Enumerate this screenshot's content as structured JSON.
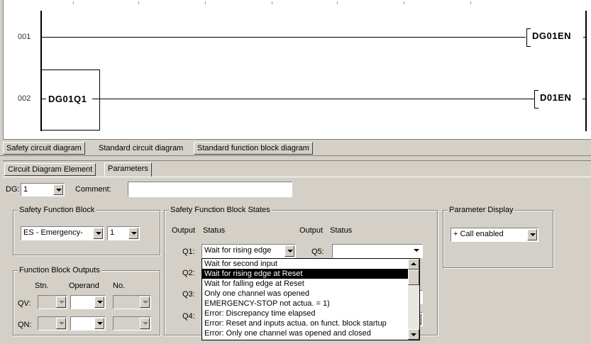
{
  "diagram": {
    "rungs": [
      {
        "number": "001",
        "contact": "",
        "coil": "DG01EN"
      },
      {
        "number": "002",
        "contact": "DG01Q1",
        "coil": "D01EN"
      }
    ]
  },
  "diagram_tabs": [
    "Safety circuit diagram",
    "Standard circuit diagram",
    "Standard function block diagram"
  ],
  "panel_tabs": [
    "Circuit Diagram Element",
    "Parameters"
  ],
  "header": {
    "dg_label": "DG:",
    "dg_value": "1",
    "comment_label": "Comment:",
    "comment_value": ""
  },
  "safety_function_block": {
    "title": "Safety Function Block",
    "type_value": "ES - Emergency-",
    "number_value": "1"
  },
  "function_block_outputs": {
    "title": "Function Block Outputs",
    "col_stn": "Stn.",
    "col_operand": "Operand",
    "col_no": "No.",
    "row_qv": "QV:",
    "row_qn": "QN:"
  },
  "states": {
    "title": "Safety Function Block States",
    "col_output": "Output",
    "col_status": "Status",
    "col_output2": "Output",
    "col_status2": "Status",
    "q1": "Q1:",
    "q1_value": "Wait for rising edge",
    "q2": "Q2:",
    "q3": "Q3:",
    "q4": "Q4:",
    "q5": "Q5:",
    "q5_value": "",
    "dropdown": [
      "Wait for second input",
      "Wait for rising edge at Reset",
      "Wait for falling edge at Reset",
      "Only one channel was opened",
      "EMERGENCY-STOP not actua.  = 1)",
      "Error: Discrepancy time elapsed",
      "Error: Reset and inputs actua. on funct. block startup",
      "Error: Only one channel was opened and closed"
    ],
    "dropdown_selected_index": 1
  },
  "parameter_display": {
    "title": "Parameter Display",
    "value": "+ Call enabled"
  }
}
